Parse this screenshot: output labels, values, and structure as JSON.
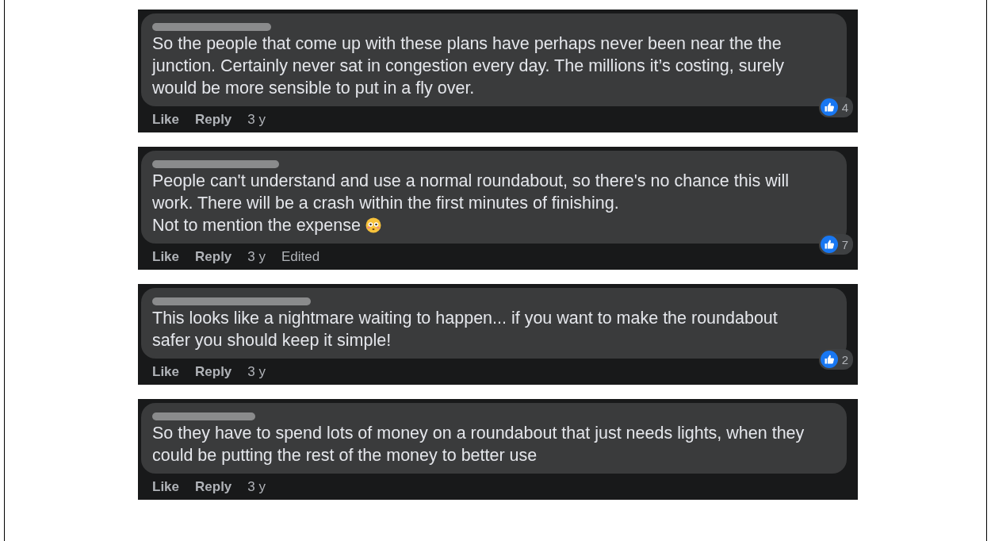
{
  "comments": [
    {
      "lines": [
        "So the people that come up with these plans have perhaps never been near the the",
        "junction. Certainly never sat in congestion every day. The millions it’s costing, surely",
        "would be more sensible to put in a fly over."
      ],
      "emoji": false,
      "actions": [
        "Like",
        "Reply"
      ],
      "time": "3 y",
      "reactions": "4"
    },
    {
      "lines": [
        "People can't understand and use a normal roundabout, so there's no chance this will",
        "work. There will be a crash within the first minutes of finishing.",
        "Not to mention the expense"
      ],
      "emoji": true,
      "actions": [
        "Like",
        "Reply"
      ],
      "time": "3 y",
      "edited": "Edited",
      "reactions": "7"
    },
    {
      "lines": [
        "This looks like a nightmare waiting to happen... if you want to make the roundabout",
        "safer you should keep it simple!"
      ],
      "emoji": false,
      "actions": [
        "Like",
        "Reply"
      ],
      "time": "3 y",
      "reactions": "2"
    },
    {
      "lines": [
        "So they have to spend lots of money on a roundabout that just needs lights, when they",
        "could be putting the rest of the money to better use"
      ],
      "emoji": false,
      "actions": [
        "Like",
        "Reply"
      ],
      "time": "3 y"
    }
  ]
}
